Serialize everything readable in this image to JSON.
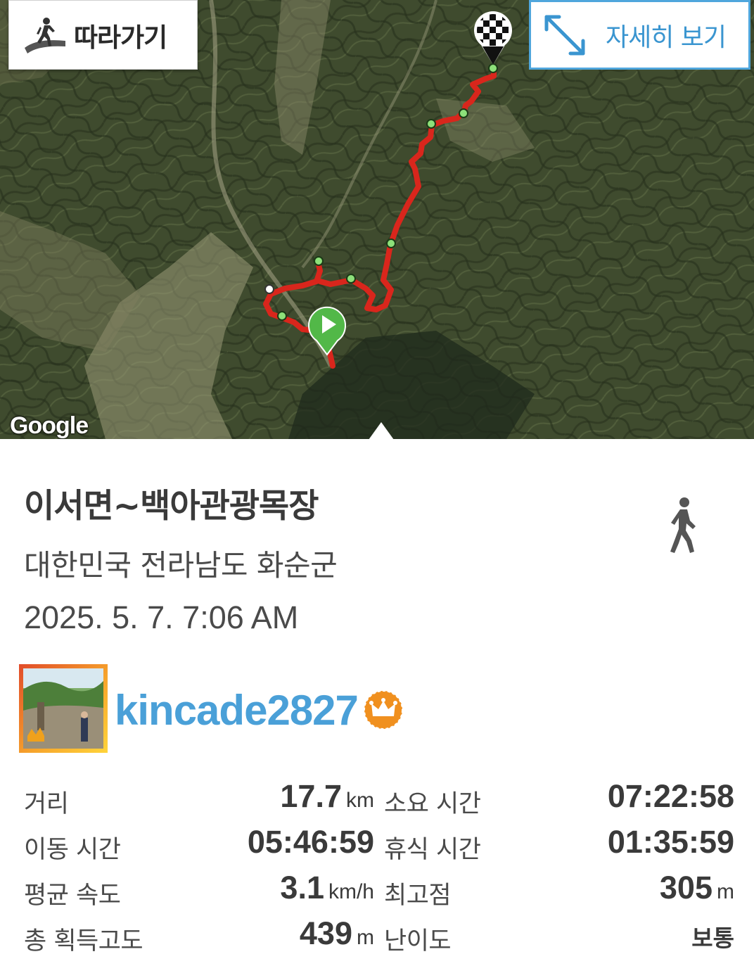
{
  "map": {
    "follow_label": "따라가기",
    "detail_label": "자세히 보기",
    "attribution": "Google",
    "icons": {
      "follow": "hiker-on-path-icon",
      "detail": "expand-arrows-icon",
      "start": "play-marker-icon",
      "finish": "checkered-flag-marker-icon"
    },
    "route_color": "#d9261c"
  },
  "track": {
    "title": "이서면~백아관광목장",
    "location": "대한민국 전라남도 화순군",
    "datetime": "2025. 5. 7. 7:06 AM",
    "activity_icon": "walking-person-icon"
  },
  "user": {
    "name": "kincade2827",
    "badge_icon": "crown-badge-icon",
    "accent_color": "#4aa0d8"
  },
  "stats": {
    "distance": {
      "label": "거리",
      "value": "17.7",
      "unit": "km"
    },
    "total_time": {
      "label": "소요 시간",
      "value": "07:22:58",
      "unit": ""
    },
    "moving_time": {
      "label": "이동 시간",
      "value": "05:46:59",
      "unit": ""
    },
    "rest_time": {
      "label": "휴식 시간",
      "value": "01:35:59",
      "unit": ""
    },
    "avg_speed": {
      "label": "평균 속도",
      "value": "3.1",
      "unit": "km/h"
    },
    "max_elevation": {
      "label": "최고점",
      "value": "305",
      "unit": "m"
    },
    "total_ascent": {
      "label": "총 획득고도",
      "value": "439",
      "unit": "m"
    },
    "difficulty": {
      "label": "난이도",
      "value": "보통",
      "unit": ""
    }
  }
}
